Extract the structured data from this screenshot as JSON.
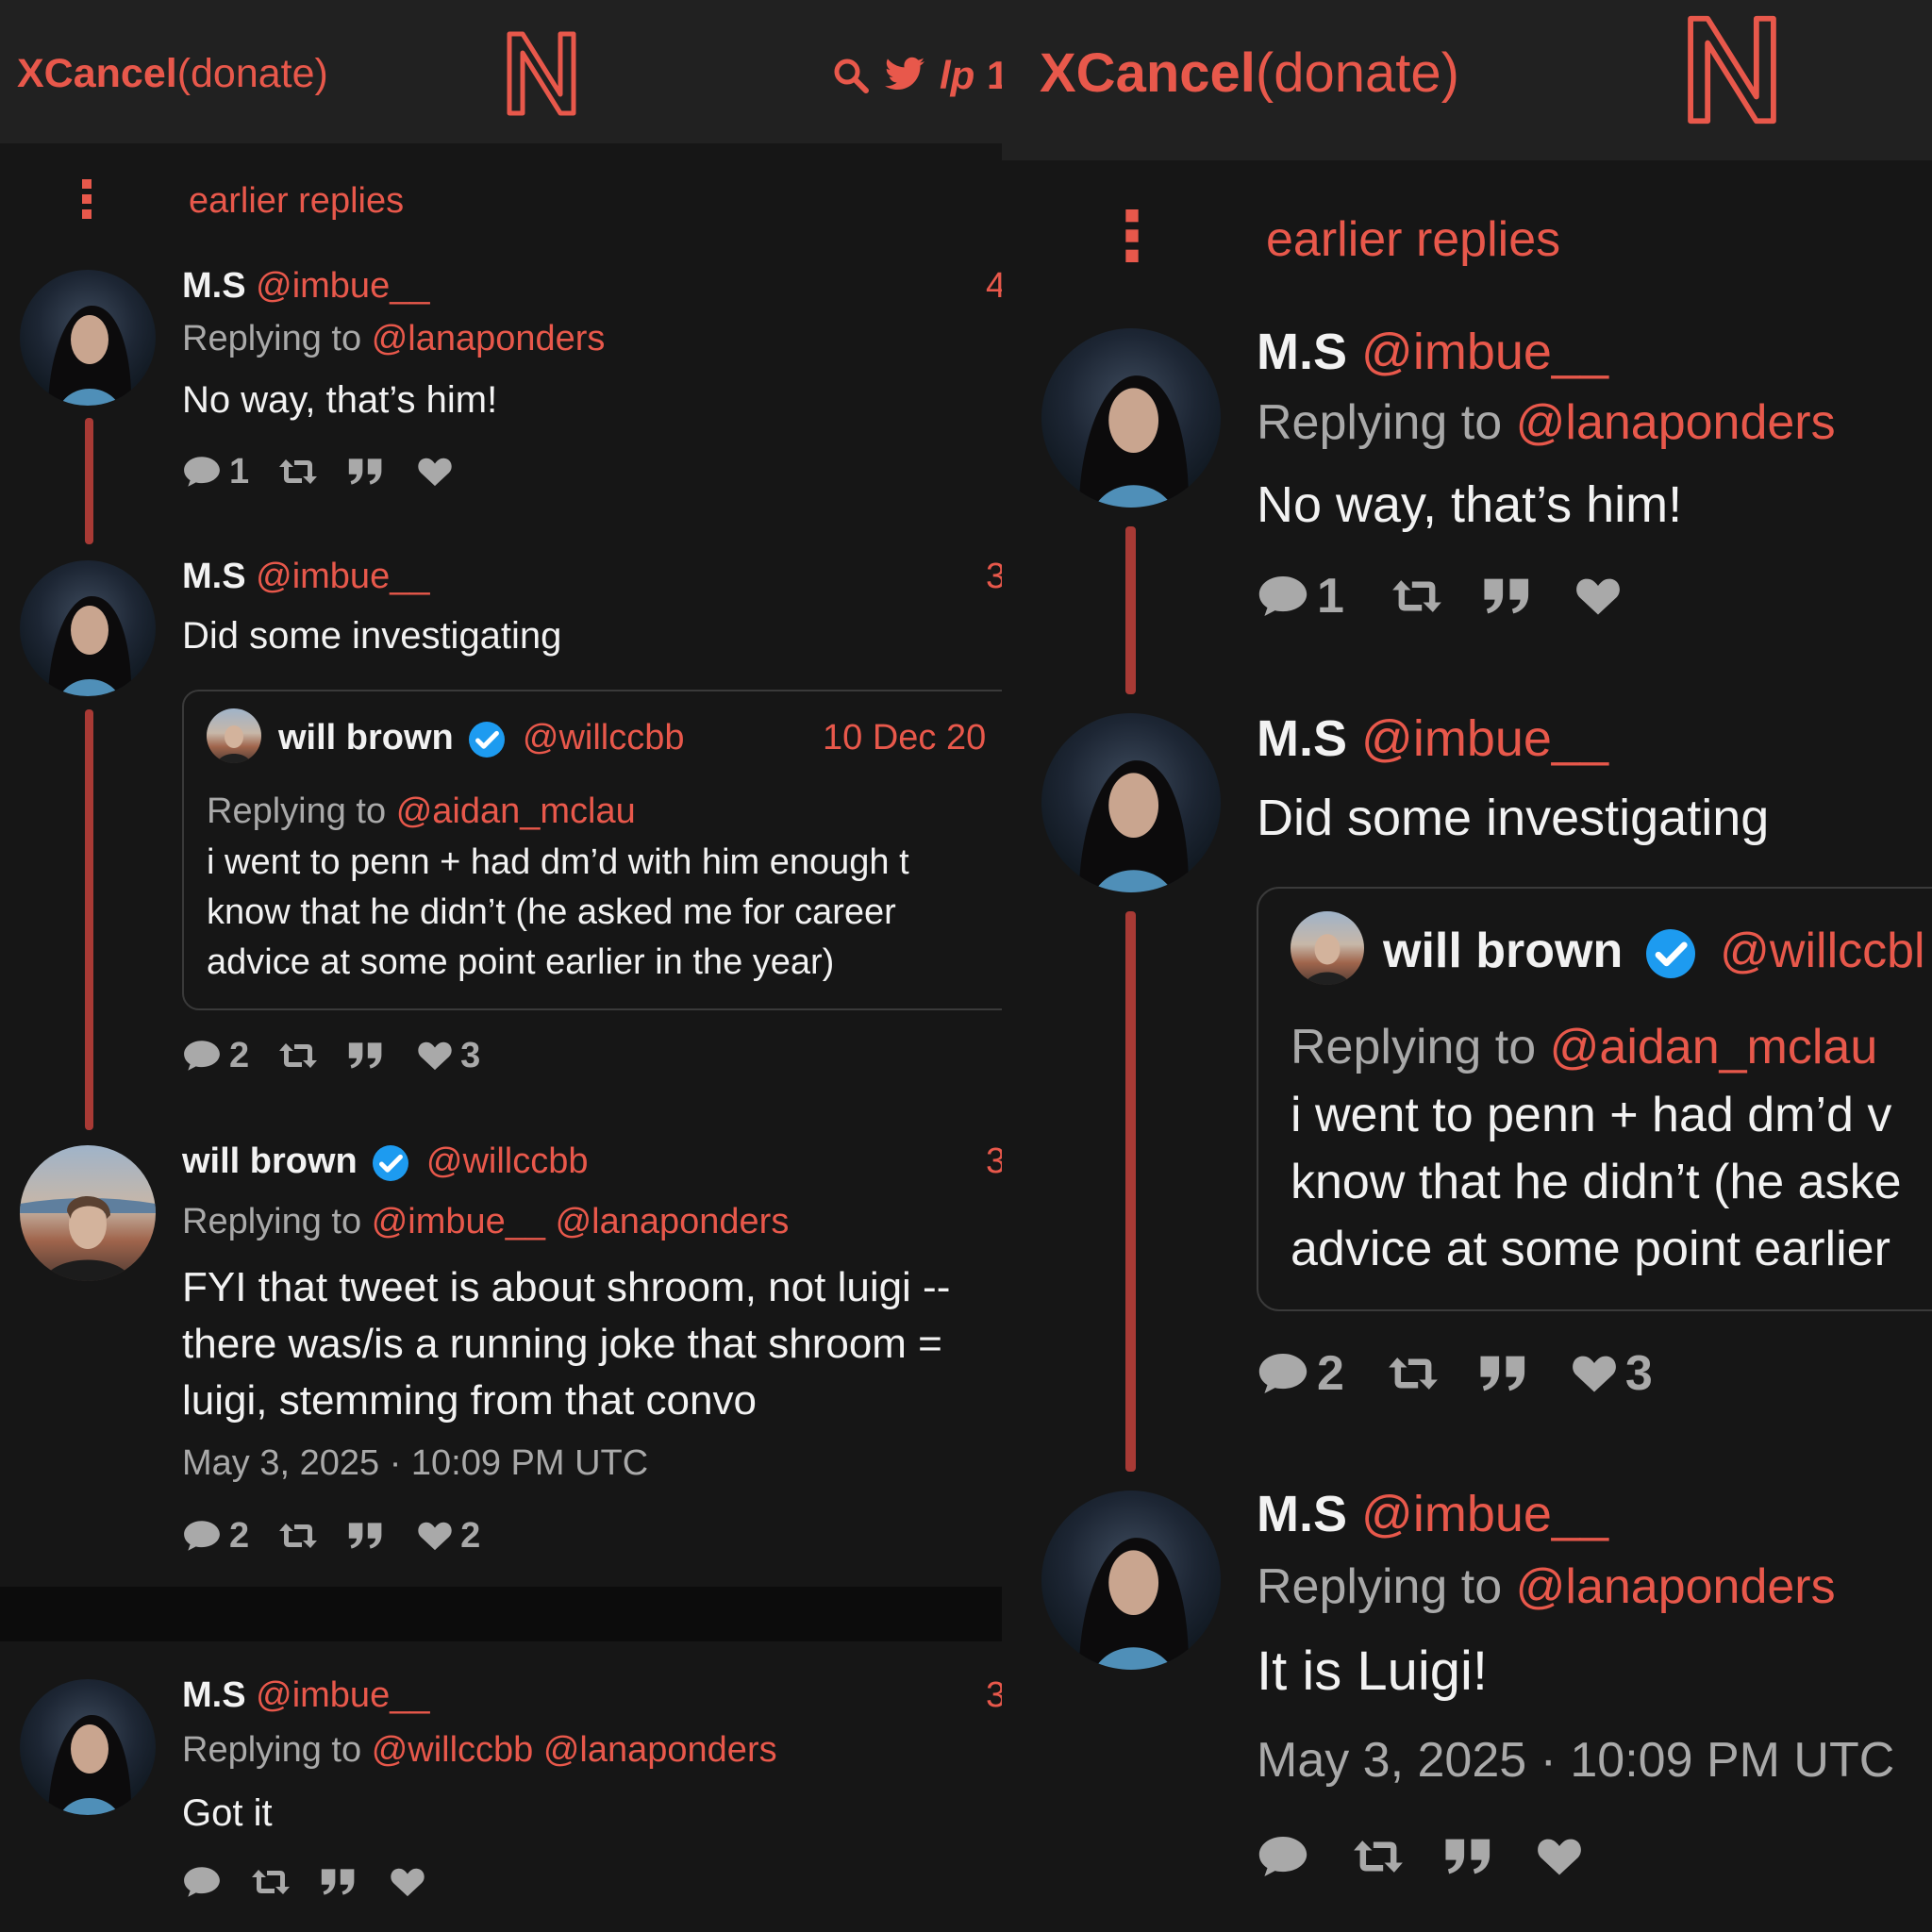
{
  "colors": {
    "accent": "#e8584b",
    "background": "#161616",
    "topbar": "#212121",
    "thread_line": "#a83a35",
    "muted": "#a9a9a9",
    "text": "#f2f2f2",
    "verified": "#1d9bf0"
  },
  "header": {
    "brand_bold": "XCancel",
    "brand_link": "(donate)",
    "logo_letter": "N",
    "icons": [
      "search-icon",
      "twitter-icon",
      "liberapay-icon"
    ],
    "truncated_icon_text": "1"
  },
  "earlier_replies": "earlier replies",
  "left": {
    "tweets": [
      {
        "name": "M.S",
        "handle": "@imbue__",
        "reply_label": "Replying to",
        "reply_to": "@lanaponders",
        "text": "No way, that’s him!",
        "time_trunc": "4",
        "stats": {
          "comments": "1",
          "retweets": "",
          "quotes": "",
          "likes": ""
        }
      },
      {
        "name": "M.S",
        "handle": "@imbue__",
        "text": "Did some investigating",
        "time_trunc": "3",
        "quote": {
          "name": "will brown",
          "handle": "@willccbb",
          "date": "10 Dec 20",
          "reply_label": "Replying to",
          "reply_to": "@aidan_mclau",
          "lines": [
            "i went to penn + had dm’d with him enough t",
            "know that he didn’t (he asked me for career",
            "advice at some point earlier in the year)"
          ]
        },
        "stats": {
          "comments": "2",
          "retweets": "",
          "quotes": "",
          "likes": "3"
        }
      },
      {
        "name": "will brown",
        "handle": "@willccbb",
        "reply_label": "Replying to",
        "reply_to": "@imbue__ @lanaponders",
        "time_trunc": "3",
        "lines": [
          "FYI that tweet is about shroom, not luigi --",
          "there was/is a running joke that shroom =",
          "luigi, stemming from that convo"
        ],
        "timestamp": "May 3, 2025 · 10:09 PM UTC",
        "stats": {
          "comments": "2",
          "retweets": "",
          "quotes": "",
          "likes": "2"
        }
      },
      {
        "name": "M.S",
        "handle": "@imbue__",
        "reply_label": "Replying to",
        "reply_to": "@willccbb @lanaponders",
        "text": "Got it",
        "time_trunc": "3",
        "stats": {
          "comments": "",
          "retweets": "",
          "quotes": "",
          "likes": ""
        }
      }
    ]
  },
  "right": {
    "tweets": [
      {
        "name": "M.S",
        "handle": "@imbue__",
        "reply_label": "Replying to",
        "reply_to": "@lanaponders",
        "text": "No way, that’s him!",
        "stats": {
          "comments": "1",
          "likes": ""
        }
      },
      {
        "name": "M.S",
        "handle": "@imbue__",
        "text": "Did some investigating",
        "quote": {
          "name": "will brown",
          "handle": "@willccbl",
          "reply_label": "Replying to",
          "reply_to": "@aidan_mclau",
          "lines": [
            "i went to penn + had dm’d v",
            "know that he didn’t (he aske",
            "advice at some point earlier"
          ]
        },
        "stats": {
          "comments": "2",
          "likes": "3"
        }
      },
      {
        "name": "M.S",
        "handle": "@imbue__",
        "reply_label": "Replying to",
        "reply_to": "@lanaponders",
        "text": "It is Luigi!",
        "timestamp": "May 3, 2025 · 10:09 PM UTC",
        "stats": {
          "comments": "",
          "likes": ""
        }
      }
    ]
  }
}
